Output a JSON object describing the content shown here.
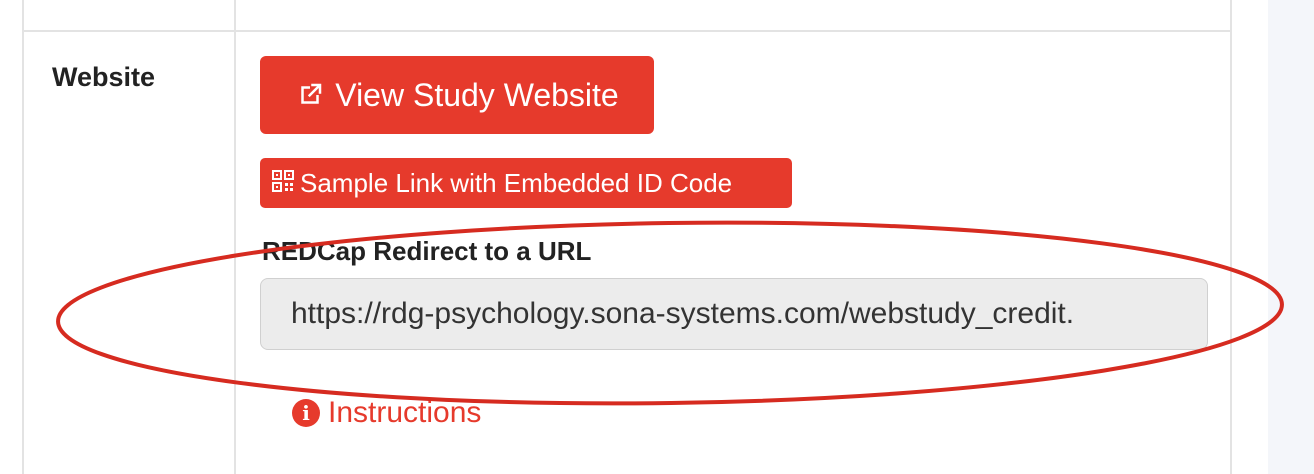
{
  "row": {
    "label": "Website"
  },
  "buttons": {
    "view_study_website": "View Study Website",
    "sample_link": "Sample Link with Embedded ID Code"
  },
  "redirect": {
    "label": "REDCap Redirect to a URL",
    "value": "https://rdg-psychology.sona-systems.com/webstudy_credit."
  },
  "instructions": {
    "label": "Instructions"
  },
  "icons": {
    "external_link": "external-link-icon",
    "qr_code": "qr-code-icon",
    "info": "info-circle-icon"
  },
  "colors": {
    "accent": "#e63a2c",
    "annotation": "#d62b20",
    "field_bg": "#ececec"
  }
}
